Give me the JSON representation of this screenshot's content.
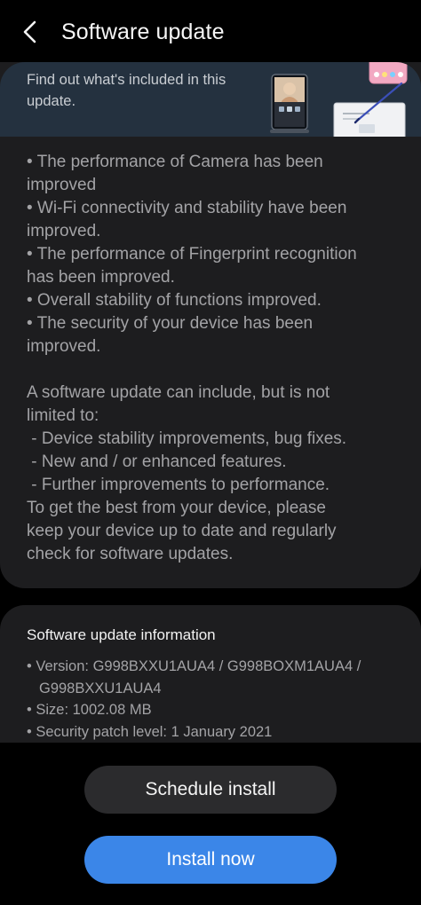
{
  "header": {
    "title": "Software update"
  },
  "banner": {
    "text": "Find out what's included in this update."
  },
  "release_notes": [
    "• The performance of Camera has been",
    "improved",
    "• Wi-Fi connectivity and stability have been",
    "improved.",
    "• The performance of Fingerprint recognition",
    "has been improved.",
    "• Overall stability of functions improved.",
    "• The security of your device has been",
    "improved.",
    "",
    "A software update can include, but is not",
    "limited to:",
    " - Device stability improvements, bug fixes.",
    " - New and / or enhanced features.",
    " - Further improvements to performance.",
    "To get the best from your device, please",
    "keep your device up to date and regularly",
    "check for software updates."
  ],
  "info": {
    "title": "Software update information",
    "version_line1": "• Version: G998BXXU1AUA4 / G998BOXM1AUA4 /",
    "version_line2": "G998BXXU1AUA4",
    "size": "• Size: 1002.08 MB",
    "security_patch": "• Security patch level: 1 January 2021"
  },
  "buttons": {
    "schedule_label": "Schedule install",
    "install_label": "Install now"
  },
  "colors": {
    "background": "#000000",
    "card": "#1d1d1f",
    "banner": "#24313f",
    "secondary_button": "#2b2b2d",
    "primary_button": "#3b86e8",
    "body_text": "#a3a3a6"
  },
  "icons": {
    "back": "chevron-left-icon",
    "banner_art": "devices-illustration"
  }
}
